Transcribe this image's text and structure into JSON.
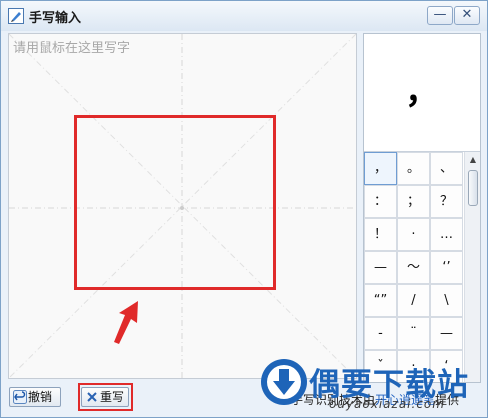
{
  "window": {
    "title": "手写输入"
  },
  "titlebar": {
    "minimize_glyph": "—",
    "close_glyph": "✕"
  },
  "pad": {
    "placeholder": "请用鼠标在这里写字"
  },
  "candidates": {
    "preview": "，",
    "grid": [
      "，",
      "。",
      "、",
      "：",
      "；",
      "？",
      "！",
      "·",
      "…",
      "—",
      "～",
      "‘’",
      "“”",
      "/",
      "\\",
      "-",
      "¨",
      "—",
      "ˇ",
      "·",
      "‘"
    ]
  },
  "buttons": {
    "undo": "撤销",
    "rewrite": "重写"
  },
  "credit": {
    "prefix": "手写识别技术由",
    "link": "开心逍遥笔",
    "suffix": "提供"
  },
  "watermark": {
    "brand": "偶要下载站",
    "domain": "ouyaoxiazai.com"
  },
  "colors": {
    "highlight_red": "#e02a2a",
    "accent_blue": "#1d5fbf"
  }
}
